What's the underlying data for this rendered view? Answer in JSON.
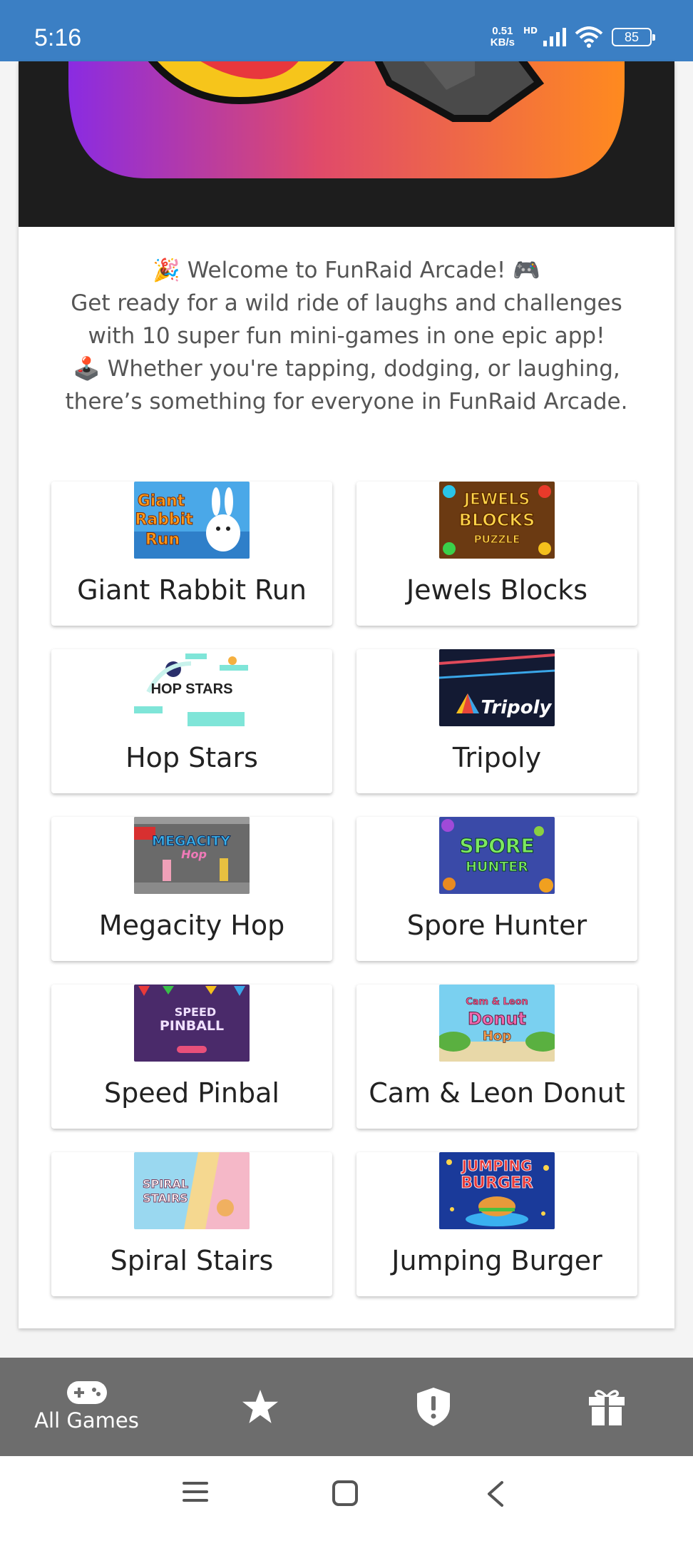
{
  "status_bar": {
    "time": "5:16",
    "speed_value": "0.51",
    "speed_unit": "KB/s",
    "network_tag": "HD",
    "battery": "85"
  },
  "welcome": {
    "line1_emoji": "🎉",
    "line1": "Welcome to FunRaid Arcade!",
    "line1_end_emoji": "🎮",
    "line2": "Get ready for a wild ride of laughs and challenges",
    "line3": "with 10 super fun mini-games in one epic app!",
    "line4_emoji": "🕹️",
    "line4": "Whether you're tapping, dodging, or laughing,",
    "line5": "there’s something for everyone in FunRaid Arcade."
  },
  "games": [
    {
      "name": "Giant Rabbit Run",
      "thumb_text": [
        "Giant",
        "Rabbit",
        "Run"
      ],
      "icon": "giant-rabbit-run-thumbnail"
    },
    {
      "name": "Jewels Blocks",
      "thumb_text": [
        "JEWELS",
        "BLOCKS",
        "PUZZLE"
      ],
      "icon": "jewels-blocks-thumbnail"
    },
    {
      "name": "Hop Stars",
      "thumb_text": [
        "HOP STARS"
      ],
      "icon": "hop-stars-thumbnail"
    },
    {
      "name": "Tripoly",
      "thumb_text": [
        "Tripoly"
      ],
      "icon": "tripoly-thumbnail"
    },
    {
      "name": "Megacity Hop",
      "thumb_text": [
        "MEGACITY",
        "Hop"
      ],
      "icon": "megacity-hop-thumbnail"
    },
    {
      "name": "Spore Hunter",
      "thumb_text": [
        "SPORE",
        "HUNTER"
      ],
      "icon": "spore-hunter-thumbnail"
    },
    {
      "name": "Speed Pinbal",
      "thumb_text": [
        "SPEED",
        "PINBALL"
      ],
      "icon": "speed-pinball-thumbnail"
    },
    {
      "name": "Cam & Leon Donut",
      "thumb_text": [
        "Cam & Leon",
        "Donut",
        "Hop"
      ],
      "icon": "cam-leon-donut-thumbnail"
    },
    {
      "name": "Spiral Stairs",
      "thumb_text": [
        "SPIRAL",
        "STAIRS"
      ],
      "icon": "spiral-stairs-thumbnail"
    },
    {
      "name": "Jumping Burger",
      "thumb_text": [
        "JUMPING",
        "BURGER"
      ],
      "icon": "jumping-burger-thumbnail"
    }
  ],
  "bottom_nav": {
    "all_games_label": "All Games",
    "items": [
      "gamepad-icon",
      "star-icon",
      "shield-alert-icon",
      "gift-icon"
    ]
  },
  "colors": {
    "status_bar": "#3b7fc4",
    "bottom_nav": "#6d6d6d",
    "welcome_text": "#555555"
  }
}
